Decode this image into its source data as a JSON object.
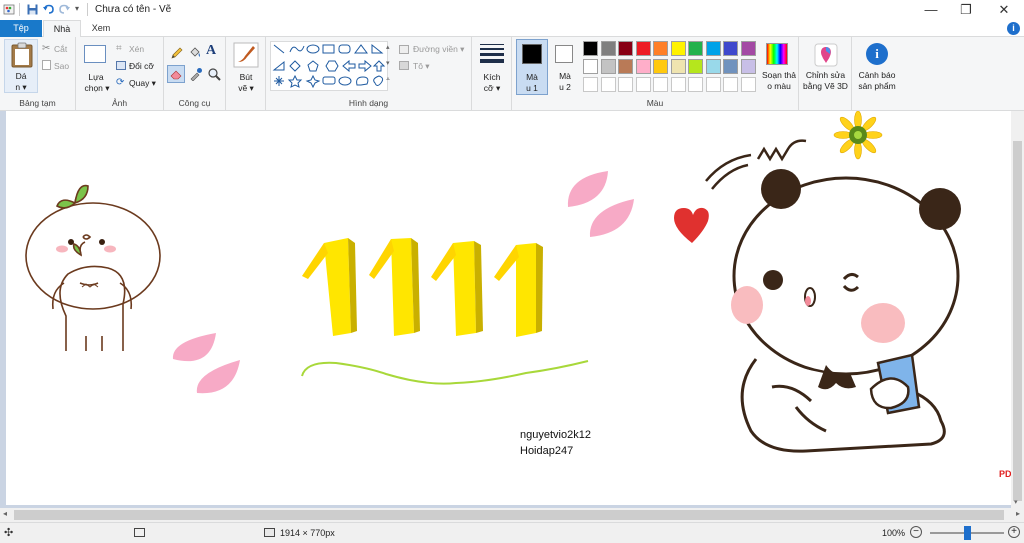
{
  "window": {
    "title": "Chưa có tên - Vẽ",
    "minimize": "—",
    "maximize": "❐",
    "close": "✕"
  },
  "tabs": [
    {
      "label": "Tệp"
    },
    {
      "label": "Nhà"
    },
    {
      "label": "Xem"
    }
  ],
  "help_label": "i",
  "ribbon": {
    "clipboard": {
      "paste_line1": "Dá",
      "paste_line2": "n ▾",
      "cut": "Cắt",
      "copy": "Sao",
      "group": "Bảng tạm"
    },
    "image": {
      "select_line1": "Lựa",
      "select_line2": "chọn ▾",
      "crop": "Xén",
      "resize": "Đổi cỡ",
      "rotate": "Quay ▾",
      "group": "Ảnh"
    },
    "tools": {
      "group": "Công cụ"
    },
    "brushes": {
      "line1": "Bút",
      "line2": "vẽ ▾"
    },
    "shapes": {
      "outline": "Đường viền ▾",
      "fill": "Tô ▾",
      "group": "Hình dạng"
    },
    "size": {
      "line1": "Kích",
      "line2": "cỡ ▾"
    },
    "colors": {
      "color1_line1": "Mà",
      "color1_line2": "u 1",
      "color2_line1": "Mà",
      "color2_line2": "u 2",
      "edit_line1": "Soạn thả",
      "edit_line2": "o màu",
      "group": "Màu",
      "color1_value": "#000000",
      "color2_value": "#ffffff",
      "palette_row1": [
        "#000000",
        "#7f7f7f",
        "#880015",
        "#ed1c24",
        "#ff7f27",
        "#fff200",
        "#22b14c",
        "#00a2e8",
        "#3f48cc",
        "#a349a4"
      ],
      "palette_row2": [
        "#ffffff",
        "#c3c3c3",
        "#b97a57",
        "#ffaec9",
        "#ffc90e",
        "#efe4b0",
        "#b5e61d",
        "#99d9ea",
        "#7092be",
        "#c8bfe7"
      ]
    },
    "paint3d": {
      "line1": "Chỉnh sửa",
      "line2": "bằng Vẽ 3D"
    },
    "alert": {
      "line1": "Cảnh báo",
      "line2": "sản phẩm"
    }
  },
  "canvas": {
    "text_line1": "nguyetvio2k12",
    "text_line2": "Hoidap247",
    "corner_mark": "PD",
    "big_number": "1111"
  },
  "status": {
    "dimensions": "1914 × 770px",
    "zoom": "100%",
    "zoom_level": 0.5
  }
}
